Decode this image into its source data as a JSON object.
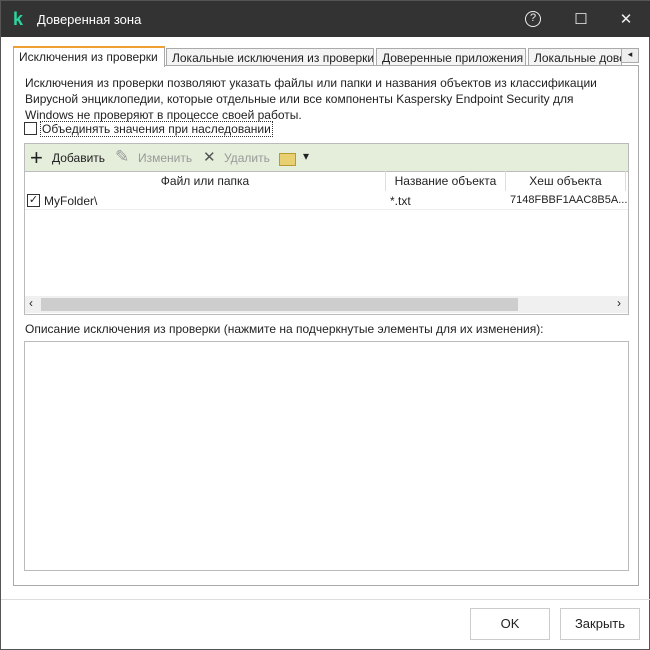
{
  "window": {
    "title": "Доверенная зона",
    "help": "?",
    "maximize": "☐",
    "close": "✕",
    "logo": "k"
  },
  "tabs": [
    {
      "label": "Исключения из проверки",
      "active": true
    },
    {
      "label": "Локальные исключения из проверки"
    },
    {
      "label": "Доверенные приложения"
    },
    {
      "label": "Локальные доверенные приложения"
    }
  ],
  "tab_scroll": {
    "left": "◂",
    "right": "▸"
  },
  "description": "Исключения из проверки позволяют указать файлы или папки и названия объектов из классификации Вирусной энциклопедии, которые отдельные или все компоненты Kaspersky Endpoint Security для Windows не проверяют в процессе своей работы.",
  "merge_checkbox": {
    "label": "Объединять значения при наследовании",
    "checked": false
  },
  "toolbar": {
    "add": "Добавить",
    "edit": "Изменить",
    "delete": "Удалить",
    "add_icon": "+",
    "edit_icon": "✎",
    "delete_icon": "✕",
    "dropdown": "▾"
  },
  "table": {
    "columns": [
      "Файл или папка",
      "Название объекта",
      "Хеш объекта"
    ],
    "rows": [
      {
        "checked": true,
        "check_mark": "✓",
        "path": "MyFolder\\",
        "object": "*.txt",
        "hash": "7148FBBF1AAC8B5A..."
      }
    ]
  },
  "scrollbar": {
    "left": "‹",
    "right": "›"
  },
  "desc_label": "Описание исключения из проверки (нажмите на подчеркнутые элементы для их изменения):",
  "buttons": {
    "ok": "OK",
    "close": "Закрыть"
  }
}
